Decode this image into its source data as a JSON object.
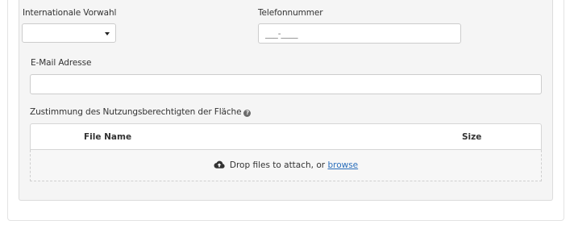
{
  "form": {
    "country_code": {
      "label": "Internationale Vorwahl",
      "value": ""
    },
    "phone": {
      "label": "Telefonnummer",
      "placeholder": "___-____"
    },
    "email": {
      "label": "E-Mail Adresse",
      "value": ""
    },
    "consent": {
      "label": "Zustimmung des Nutzungsberechtigten der Fläche",
      "help_icon": "question-circle-icon",
      "help_glyph": "?"
    }
  },
  "file_upload": {
    "columns": [
      "File Name",
      "Size"
    ],
    "drop_text": "Drop files to attach, or",
    "browse_label": "browse",
    "upload_icon": "cloud-upload-icon"
  },
  "colors": {
    "panel_bg": "#f5f5f5",
    "link": "#2a6ebb",
    "border": "#cccccc"
  }
}
